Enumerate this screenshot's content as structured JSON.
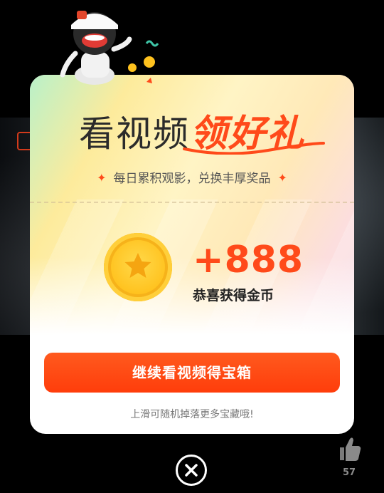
{
  "modal": {
    "title_plain": "看视频",
    "title_highlight": "领好礼",
    "subtitle": "每日累积观影，兑换丰厚奖品",
    "reward_amount": "+888",
    "reward_label": "恭喜获得金币",
    "cta_label": "继续看视频得宝箱",
    "hint": "上滑可随机掉落更多宝藏哦!"
  },
  "side": {
    "like_count": "57"
  },
  "colors": {
    "accent": "#ff4a1a",
    "coin": "#ffc21e",
    "modal_bg": "#ffffff"
  },
  "icons": {
    "close": "close-icon",
    "like": "thumb-up-icon",
    "coin": "star-coin-icon"
  }
}
